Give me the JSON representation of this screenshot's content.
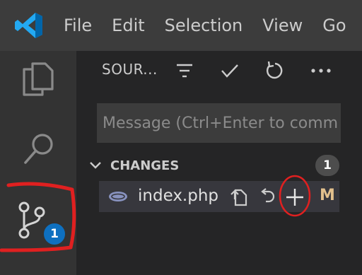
{
  "menu": {
    "items": [
      "File",
      "Edit",
      "Selection",
      "View",
      "Go"
    ]
  },
  "activity": {
    "scm_badge": "1"
  },
  "scm": {
    "view_title": "SOUR...",
    "message_placeholder": "Message (Ctrl+Enter to comm",
    "changes_label": "CHANGES",
    "changes_count": "1",
    "files": [
      {
        "name": "index.php",
        "status": "M"
      }
    ]
  },
  "colors": {
    "accent": "#0e70c0",
    "annotation": "#e02020",
    "modified": "#e2c08d"
  }
}
